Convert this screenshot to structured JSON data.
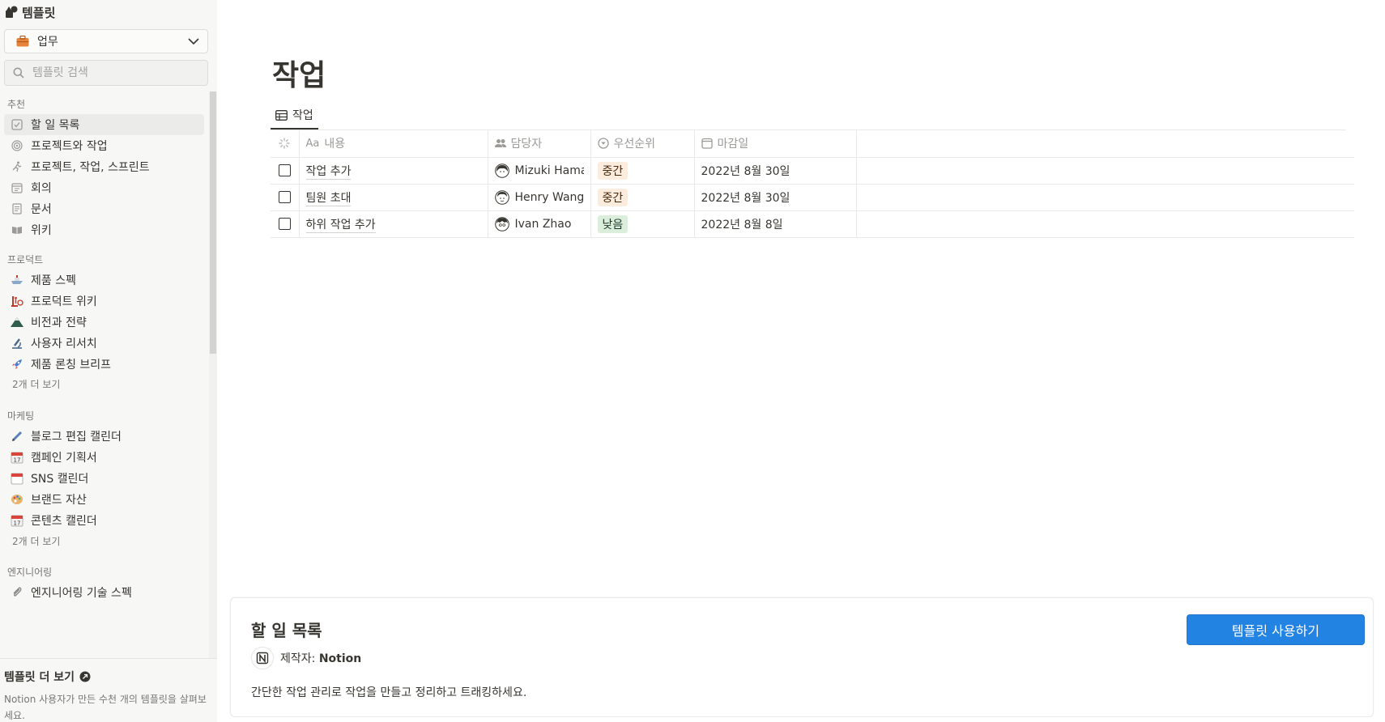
{
  "sidebar": {
    "title": "템플릿",
    "category_select": {
      "value": "업무"
    },
    "search": {
      "placeholder": "템플릿 검색"
    },
    "sections": [
      {
        "title": "추천",
        "items": [
          {
            "label": "할 일 목록",
            "icon": "checkbox-icon",
            "selected": true
          },
          {
            "label": "프로젝트와 작업",
            "icon": "target-icon"
          },
          {
            "label": "프로젝트, 작업, 스프린트",
            "icon": "runner-icon"
          },
          {
            "label": "회의",
            "icon": "calendar-note-icon"
          },
          {
            "label": "문서",
            "icon": "document-icon"
          },
          {
            "label": "위키",
            "icon": "book-icon"
          }
        ]
      },
      {
        "title": "프로덕트",
        "items": [
          {
            "label": "제품 스펙",
            "icon": "ship-icon"
          },
          {
            "label": "프로덕트 위키",
            "icon": "lab-icon"
          },
          {
            "label": "비전과 전략",
            "icon": "mountain-icon"
          },
          {
            "label": "사용자 리서치",
            "icon": "microscope-icon"
          },
          {
            "label": "제품 론칭 브리프",
            "icon": "rocket-icon"
          }
        ],
        "more": "2개 더 보기"
      },
      {
        "title": "마케팅",
        "items": [
          {
            "label": "블로그 편집 캘린더",
            "icon": "pen-icon"
          },
          {
            "label": "캠페인 기획서",
            "icon": "calendar-icon"
          },
          {
            "label": "SNS 캘린더",
            "icon": "tear-off-calendar-icon"
          },
          {
            "label": "브랜드 자산",
            "icon": "palette-icon"
          },
          {
            "label": "콘텐츠 캘린더",
            "icon": "calendar-icon"
          }
        ],
        "more": "2개 더 보기"
      },
      {
        "title": "엔지니어링",
        "items": [
          {
            "label": "엔지니어링 기술 스펙",
            "icon": "paperclip-icon"
          }
        ]
      }
    ],
    "footer": {
      "title": "템플릿 더 보기",
      "description": "Notion 사용자가 만든 수천 개의 템플릿을 살펴보세요."
    }
  },
  "page": {
    "title": "작업",
    "view_tab": "작업",
    "columns": [
      "내용",
      "담당자",
      "우선순위",
      "마감일"
    ],
    "column_prefix": "Aa",
    "rows": [
      {
        "name": "작업 추가",
        "assignee": "Mizuki Hama",
        "priority": "중간",
        "due": "2022년 8월 30일"
      },
      {
        "name": "팀원 초대",
        "assignee": "Henry Wang",
        "priority": "중간",
        "due": "2022년 8월 30일"
      },
      {
        "name": "하위 작업 추가",
        "assignee": "Ivan Zhao",
        "priority": "낮음",
        "due": "2022년 8월 8일"
      }
    ]
  },
  "preview": {
    "title": "할 일 목록",
    "author_prefix": "제작자: ",
    "author": "Notion",
    "description": "간단한 작업 관리로 작업을 만들고 정리하고 트래킹하세요.",
    "use_button": "템플릿 사용하기"
  },
  "colors": {
    "accent": "#2383e2",
    "tag_medium_bg": "#fbecdd",
    "tag_medium_text": "#49290e",
    "tag_low_bg": "#dbeddb",
    "tag_low_text": "#1c3829"
  }
}
